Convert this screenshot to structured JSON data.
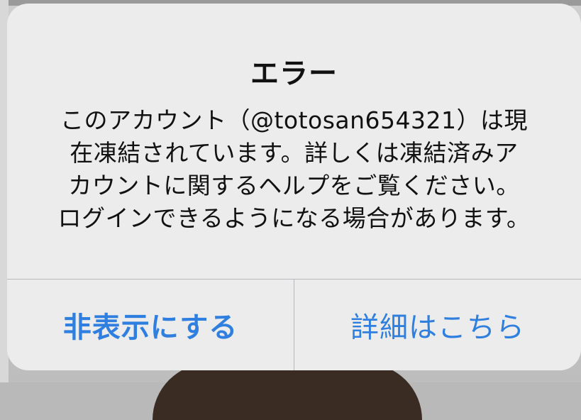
{
  "alert": {
    "title": "エラー",
    "message_lines": [
      "このアカウント（@totosan654321）は現",
      "在凍結されています。詳しくは凍結済みア",
      "カウントに関するヘルプをご覧ください。",
      "ログインできるようになる場合があります。"
    ],
    "buttons": {
      "hide": "非表示にする",
      "details": "詳細はこちら"
    }
  },
  "colors": {
    "button_text": "#2f7fe0",
    "alert_background": "#ececec",
    "title_text": "#111111"
  }
}
